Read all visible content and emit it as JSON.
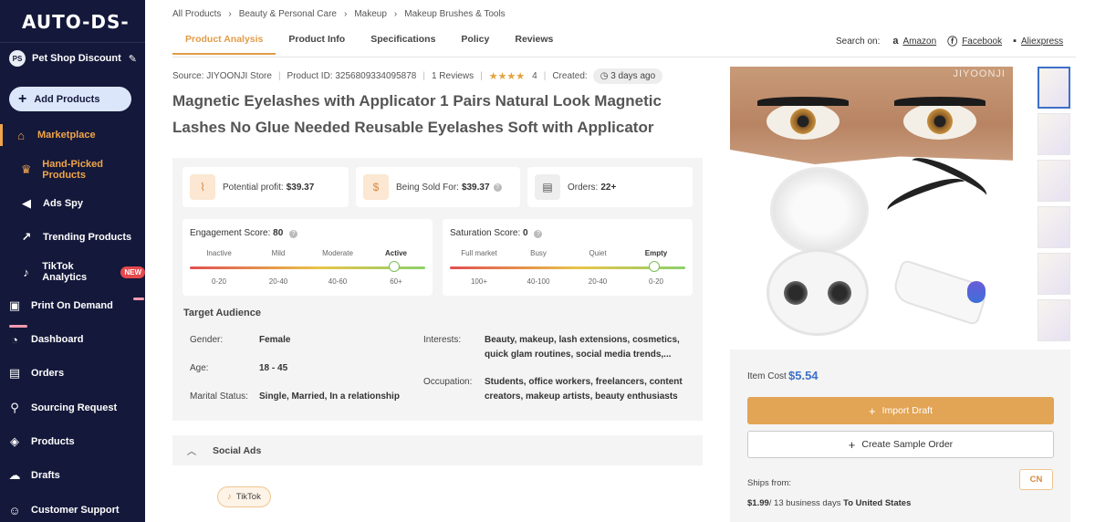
{
  "sidebar": {
    "logo": "AUTO-DS-",
    "store": {
      "initials": "PS",
      "name": "Pet Shop Discount"
    },
    "add_products": "Add Products",
    "items": [
      {
        "label": "Marketplace",
        "icon": "store-icon"
      },
      {
        "label": "Hand-Picked Products",
        "icon": "crown-icon"
      },
      {
        "label": "Ads Spy",
        "icon": "megaphone-icon"
      },
      {
        "label": "Trending Products",
        "icon": "trend-icon"
      },
      {
        "label": "TikTok Analytics",
        "icon": "tiktok-icon",
        "badge": "NEW"
      },
      {
        "label": "Print On Demand",
        "icon": "shirt-icon"
      },
      {
        "label": "Dashboard",
        "icon": "gauge-icon"
      },
      {
        "label": "Orders",
        "icon": "orders-icon"
      },
      {
        "label": "Sourcing Request",
        "icon": "sourcing-icon"
      },
      {
        "label": "Products",
        "icon": "box-icon"
      },
      {
        "label": "Drafts",
        "icon": "cloud-icon"
      },
      {
        "label": "Customer Support",
        "icon": "support-icon"
      }
    ]
  },
  "breadcrumb": [
    "All Products",
    "Beauty & Personal Care",
    "Makeup",
    "Makeup Brushes & Tools"
  ],
  "tabs": [
    "Product Analysis",
    "Product Info",
    "Specifications",
    "Policy",
    "Reviews"
  ],
  "search_on": {
    "label": "Search on:",
    "sources": [
      "Amazon",
      "Facebook",
      "Aliexpress"
    ]
  },
  "meta": {
    "source": "Source: JIYOONJI Store",
    "product_id": "Product ID: 3256809334095878",
    "reviews": "1 Reviews",
    "stars": "★★★★",
    "rating": "4",
    "created_label": "Created:",
    "created_value": "3 days ago"
  },
  "title": "Magnetic Eyelashes with Applicator 1 Pairs Natural Look Magnetic Lashes No Glue Needed Reusable Eyelashes Soft with Applicator",
  "stats": {
    "profit_label": "Potential profit:",
    "profit_value": "$39.37",
    "sold_label": "Being Sold For:",
    "sold_value": "$39.37",
    "orders_label": "Orders:",
    "orders_value": "22+"
  },
  "engagement": {
    "title": "Engagement Score:",
    "score": "80",
    "levels": [
      "Inactive",
      "Mild",
      "Moderate",
      "Active"
    ],
    "ranges": [
      "0-20",
      "20-40",
      "40-60",
      "60+"
    ],
    "level_fraction": 0.87
  },
  "saturation": {
    "title": "Saturation Score:",
    "score": "0",
    "levels": [
      "Full market",
      "Busy",
      "Quiet",
      "Empty"
    ],
    "ranges": [
      "100+",
      "40-100",
      "20-40",
      "0-20"
    ],
    "level_fraction": 0.87
  },
  "audience": {
    "title": "Target Audience",
    "gender_label": "Gender:",
    "gender": "Female",
    "age_label": "Age:",
    "age": "18 - 45",
    "marital_label": "Marital Status:",
    "marital": "Single, Married, In a relationship",
    "interests_label": "Interests:",
    "interests_1": "Beauty, makeup, lash extensions, cosmetics,",
    "interests_2": "quick glam routines, social media trends,...",
    "occupation_label": "Occupation:",
    "occupation_1": "Students, office workers, freelancers, content",
    "occupation_2": "creators, makeup artists, beauty enthusiasts"
  },
  "social": {
    "title": "Social Ads",
    "chip": "TikTok"
  },
  "image": {
    "brand": "JIYOONJI"
  },
  "buybox": {
    "cost_label": "Item Cost",
    "cost_value": "$5.54",
    "import": "Import Draft",
    "sample": "Create Sample Order",
    "ships_from": "Ships from:",
    "country": "CN",
    "ship_price": "$1.99",
    "ship_days": "/ 13 business days",
    "ship_dest": "To United States"
  },
  "colors": {
    "accent": "#e2a455",
    "sidebar": "#14183a",
    "link": "#3d70c9"
  }
}
